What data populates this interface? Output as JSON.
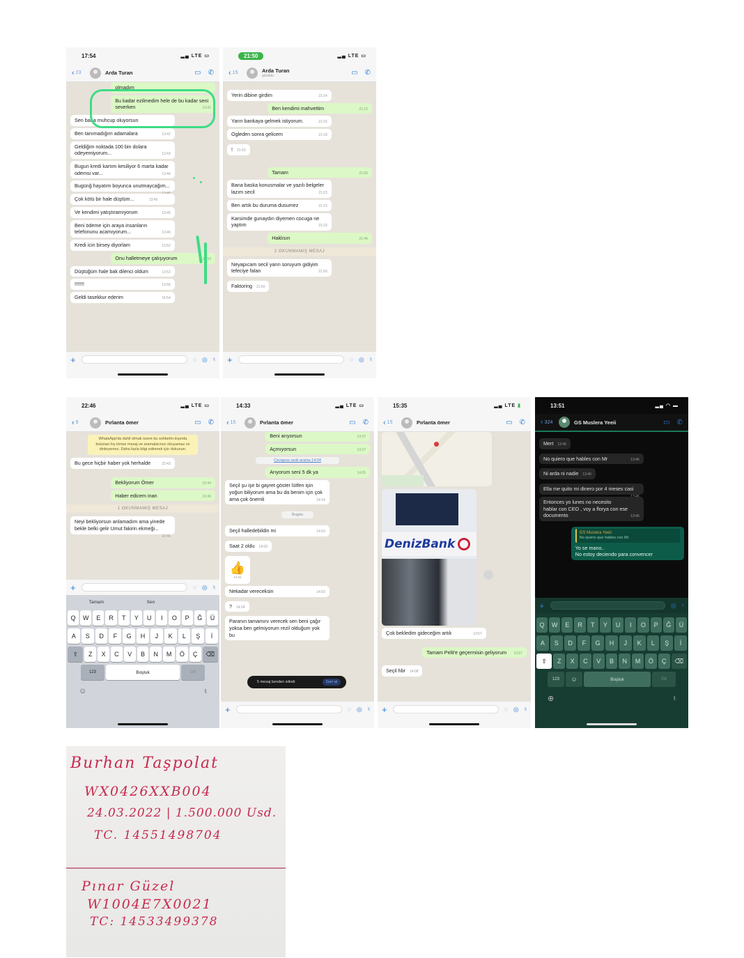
{
  "screens": [
    {
      "status_time": "17:54",
      "status_right": "LTE",
      "back_count": "23",
      "contact": "Arda Turan",
      "messages": [
        {
          "dir": "out",
          "text": "olmadım",
          "ts": ""
        },
        {
          "dir": "out",
          "text": "Bu kadar ezilmedim hele de bu kadar seni severken",
          "ts": "13:41"
        },
        {
          "dir": "in",
          "text": "Sen bana muhcup oluyorsun",
          "ts": ""
        },
        {
          "dir": "in",
          "text": "Ben tanımadığım adamalara",
          "ts": "13:42"
        },
        {
          "dir": "in",
          "text": "Geldiğim noktada 100 bin dolara odeyemiyorum...",
          "ts": "13:43"
        },
        {
          "dir": "in",
          "text": "Bugun kredi kartım kesiliyor 6 marta kadar odemsi var...",
          "ts": "13:44"
        },
        {
          "dir": "in",
          "text": "Bugünğ hayatım boyunca unutmaycağım...",
          "ts": "13:45"
        },
        {
          "dir": "in",
          "text": "Çok kötü bir hale düştüm...",
          "ts": "13:45"
        },
        {
          "dir": "in",
          "text": "Ve kendimi yatıştıramıyorum",
          "ts": "13:45"
        },
        {
          "dir": "in",
          "text": "Beni ödeme için araya insanların telefonunu acamıyorum...",
          "ts": "13:46"
        },
        {
          "dir": "in",
          "text": "Kredi icin birsey diyorlam",
          "ts": "13:52"
        },
        {
          "dir": "out",
          "text": "Onu halletmeye çalışıyorum",
          "ts": "13:53"
        },
        {
          "dir": "in",
          "text": "Düştüğüm hale bak dilenci oldum",
          "ts": "13:53"
        },
        {
          "dir": "in",
          "text": "!!!!!!!",
          "ts": "13:56"
        },
        {
          "dir": "in",
          "text": "Geldi tasekkur ederim",
          "ts": "16:54"
        }
      ]
    },
    {
      "status_time": "21:50",
      "status_right": "LTE",
      "back_count": "15",
      "contact": "Arda Turan",
      "contact_sub": "görüldü",
      "messages": [
        {
          "dir": "in",
          "text": "Yerin dibine girdim",
          "ts": "21:14"
        },
        {
          "dir": "out",
          "text": "Ben kendimi mahvettim",
          "ts": "21:15"
        },
        {
          "dir": "in",
          "text": "Yarın bankaya gelmek istiyorum.",
          "ts": "21:16"
        },
        {
          "dir": "in",
          "text": "Ogleden sonra gelicem",
          "ts": "21:18"
        },
        {
          "dir": "in",
          "text": "!",
          "ts": "21:53"
        },
        {
          "dir": "out",
          "text": "Tamam",
          "ts": "21:56"
        },
        {
          "dir": "in",
          "text": "Bana baska konusmalar ve yazılı belgeler lazım secil",
          "ts": "21:23"
        },
        {
          "dir": "in",
          "text": "Ben artık bu duruma dusumez",
          "ts": "21:23"
        },
        {
          "dir": "in",
          "text": "Karsimde gunaydın diyemen cocuga ne yaptım",
          "ts": "21:23"
        },
        {
          "dir": "out",
          "text": "Haklısın",
          "ts": "21:46"
        },
        {
          "dir": "sys",
          "text": "2 OKUNMAMIŞ MESAJ"
        },
        {
          "dir": "in",
          "text": "Neyapıcam secil yarın soruyum gidiyim tefeciye falan",
          "ts": "21:50"
        },
        {
          "dir": "in",
          "text": "Faktoring",
          "ts": "21:50"
        }
      ]
    },
    {
      "status_time": "22:46",
      "status_right": "LTE",
      "back_count": "9",
      "contact": "Pırlanta ömer",
      "notice": "WhatsApp'da dahil olmak üzere bu sohbetin dışında bulunan hiç kimse mesaj ve aramalarınızı okuyamaz ve dinleyemez. Daha fazla bilgi edinmek için dokunun.",
      "messages": [
        {
          "dir": "in",
          "text": "Bu gece hiçbir haber yok herhalde",
          "ts": "22:43"
        },
        {
          "dir": "out",
          "text": "Bekliyorum Ömer",
          "ts": "22:44"
        },
        {
          "dir": "out",
          "text": "Haber edicem inan",
          "ts": "22:45"
        },
        {
          "dir": "sys",
          "text": "1 OKUNMAMIŞ MESAJ"
        },
        {
          "dir": "in",
          "text": "Neyi bekliyorsun anlamadım ama yinede bekle belki gelir Umut fakirin ekmeği...",
          "ts": "22:46"
        }
      ],
      "suggestions": [
        "Tamam",
        "Sen"
      ],
      "keyboard": {
        "row1": [
          "Q",
          "W",
          "E",
          "R",
          "T",
          "Y",
          "U",
          "I",
          "O",
          "P",
          "Ğ",
          "Ü"
        ],
        "row2": [
          "A",
          "S",
          "D",
          "F",
          "G",
          "H",
          "J",
          "K",
          "L",
          "Ş",
          "İ"
        ],
        "row3": [
          "Z",
          "X",
          "C",
          "V",
          "B",
          "N",
          "M",
          "Ö",
          "Ç"
        ],
        "num": "123",
        "space": "Boşluk",
        "go": "Git"
      }
    },
    {
      "status_time": "14:33",
      "status_right": "LTE",
      "back_count": "15",
      "contact": "Pırlanta ömer",
      "messages": [
        {
          "dir": "out",
          "text": "Beni arıyorsun",
          "ts": "13:37"
        },
        {
          "dir": "out",
          "text": "Açmıyorsun",
          "ts": "13:37"
        },
        {
          "dir": "call",
          "text": "Cevapsız sesli arama 14:04"
        },
        {
          "dir": "out",
          "text": "Arıyorum seni 5 dk ya",
          "ts": "14:05"
        },
        {
          "dir": "in",
          "text": "Seçil şu işe bi gayret göster lütfen işin yoğun biliyorum ama bu da benim için çok ama çok önemli",
          "ts": "14:14"
        },
        {
          "dir": "date",
          "text": "Bugün"
        },
        {
          "dir": "in",
          "text": "Seçil halledebildin mi",
          "ts": "14:03"
        },
        {
          "dir": "in",
          "text": "Saat 2 oldu",
          "ts": "14:03"
        },
        {
          "dir": "sticker",
          "text": "👍",
          "ts": "14:04"
        },
        {
          "dir": "in",
          "text": "Nekadar vereceksin",
          "ts": "14:03"
        },
        {
          "dir": "in",
          "text": "?",
          "ts": "14:24"
        },
        {
          "dir": "in",
          "text": "Paranın tamamını verecek sen beni çağır yoksa ben gelmiyorum rezil olduğum yok bu",
          "ts": ""
        }
      ],
      "toast": {
        "text": "5 mesaj benden silindi",
        "action": "Geri al"
      }
    },
    {
      "status_time": "15:35",
      "status_right": "LTE",
      "back_count": "15",
      "contact": "Pırlanta ömer",
      "bank_sign": "DenizBank",
      "messages": [
        {
          "dir": "in",
          "text": "Çok bekledim gideceğim artık",
          "ts": "13:57"
        },
        {
          "dir": "out",
          "text": "Tamam Pelit'e geçermisin geliyorum",
          "ts": "13:57"
        },
        {
          "dir": "in",
          "text": "Seçil hbr",
          "ts": "14:08"
        }
      ]
    },
    {
      "status_time": "13:51",
      "status_right": "",
      "back_count": "324",
      "contact": "GS Muslera Yeeii",
      "messages": [
        {
          "dir": "in",
          "text": "Mert",
          "ts": "13:46"
        },
        {
          "dir": "in",
          "text": "No quiero que hables con Mr",
          "ts": "13:46"
        },
        {
          "dir": "in",
          "text": "Ni arda ni nadie",
          "ts": "13:46"
        },
        {
          "dir": "in",
          "text": "Ella me quito mi dinero por 4 meses casi",
          "ts": "13:46"
        },
        {
          "dir": "in",
          "text": "Entonces yo lunes no necesito hablar con CEO , voy a florya con ese documento",
          "ts": "13:46"
        }
      ],
      "reply": {
        "quoted_author": "GS Muslera Yeeii",
        "quoted_text": "No quiero que hables con Mr",
        "text": "Yo se mano..\nNo estoy deciendo para convencer"
      },
      "keyboard": {
        "num": "123",
        "space": "Boşluk",
        "go": "Git"
      }
    }
  ],
  "note": {
    "line1": "Burhan Taşpolat",
    "line2": "WX0426XXB004",
    "line3": "24.03.2022 | 1.500.000 Usd.",
    "line4": "TC. 14551498704",
    "line5": "Pınar Güzel",
    "line6": "W1004E7X0021",
    "line7": "TC: 14533499378"
  }
}
